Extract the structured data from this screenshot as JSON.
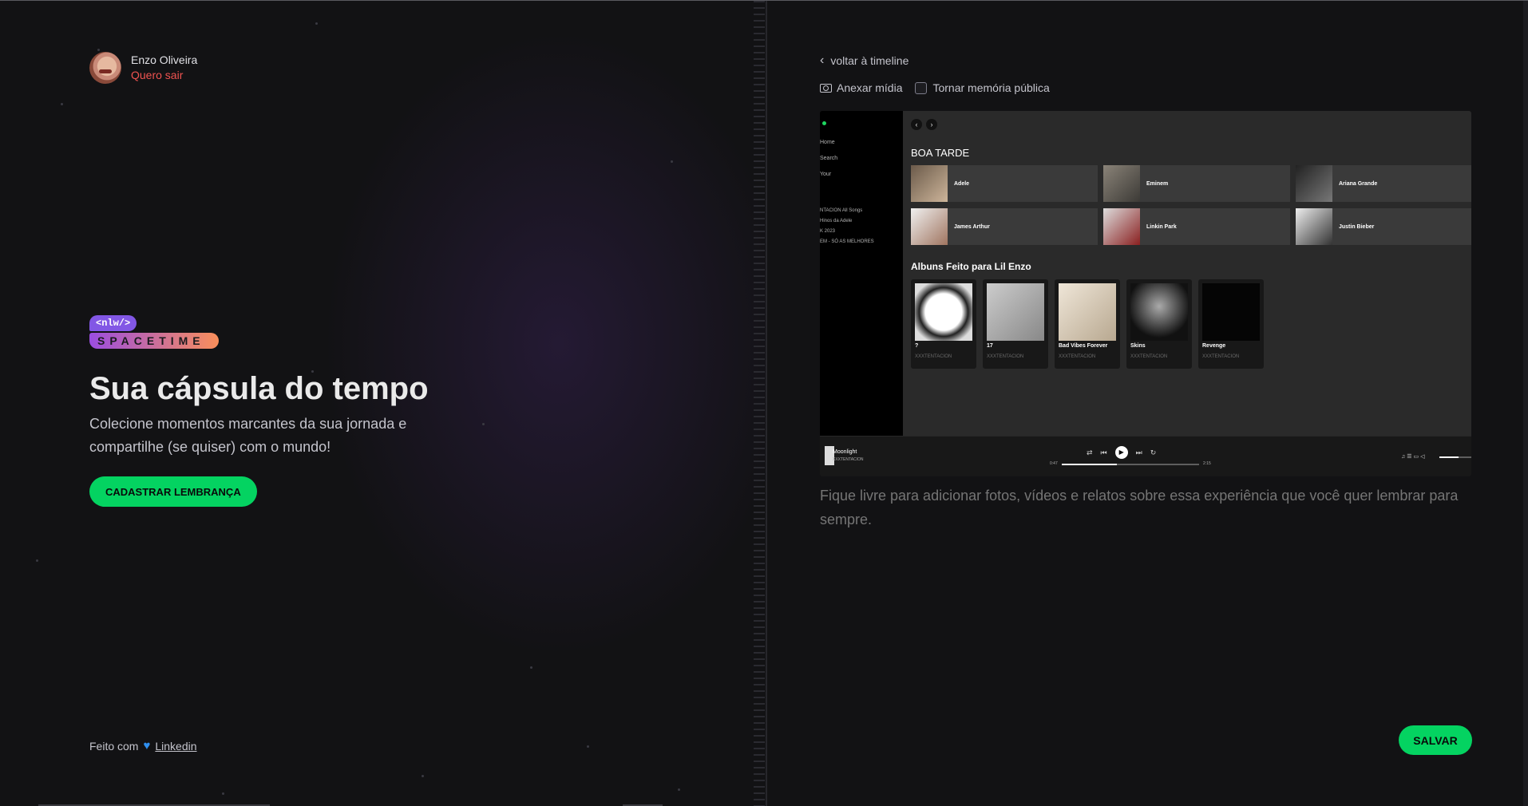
{
  "profile": {
    "name": "Enzo Oliveira",
    "logout": "Quero sair"
  },
  "brand": {
    "badge": "<nlw/>",
    "wordmark": "SPACETIME"
  },
  "hero": {
    "title": "Sua cápsula do tempo",
    "subtitle": "Colecione momentos marcantes da sua jornada e compartilhe (se quiser) com o mundo!",
    "cta": "CADASTRAR LEMBRANÇA"
  },
  "footer": {
    "made_with": "Feito com",
    "link": "Linkedin",
    "heart_color": "#2f8ff0"
  },
  "editor": {
    "back": "voltar à timeline",
    "attach": "Anexar mídia",
    "public": "Tornar memória pública",
    "placeholder": "Fique livre para adicionar fotos, vídeos e relatos sobre essa experiência que você quer lembrar para sempre.",
    "save": "SALVAR"
  },
  "media": {
    "sidebar": [
      "Home",
      "Search",
      "Your",
      "NTACION All Songs",
      "Hinos da Adele",
      "K 2023",
      "EM - SÓ AS MELHORES"
    ],
    "greeting": "BOA TARDE",
    "artists": [
      "Adele",
      "Eminem",
      "Ariana Grande",
      "James Arthur",
      "Linkin Park",
      "Justin Bieber"
    ],
    "albums_heading": "Albuns Feito para Lil Enzo",
    "albums": [
      {
        "title": "?",
        "artist": "XXXTENTACION"
      },
      {
        "title": "17",
        "artist": "XXXTENTACION"
      },
      {
        "title": "Bad Vibes Forever",
        "artist": "XXXTENTACION"
      },
      {
        "title": "Skins",
        "artist": "XXXTENTACION"
      },
      {
        "title": "Revenge",
        "artist": "XXXTENTACION"
      }
    ],
    "now_playing": {
      "song": "Moonlight",
      "artist": "XXXTENTACION",
      "elapsed": "0:47",
      "duration": "2:15",
      "progress": 0.4
    }
  },
  "colors": {
    "accent": "#04d361",
    "danger": "#ef5350",
    "brand_purple": "#8257e5",
    "brand_orange": "#f98f5a"
  }
}
